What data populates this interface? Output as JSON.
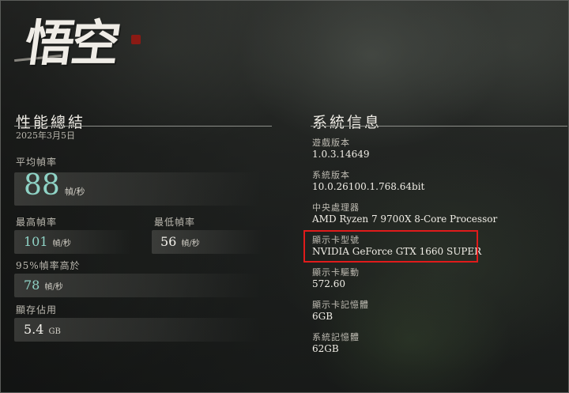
{
  "logo": {
    "text": "悟空"
  },
  "performance": {
    "title": "性能總結",
    "date": "2025年3月5日",
    "avg_fps": {
      "label": "平均幀率",
      "value": "88",
      "unit": "幀/秒"
    },
    "max_fps": {
      "label": "最高幀率",
      "value": "101",
      "unit": "幀/秒"
    },
    "min_fps": {
      "label": "最低幀率",
      "value": "56",
      "unit": "幀/秒"
    },
    "p95_fps": {
      "label": "95%幀率高於",
      "value": "78",
      "unit": "幀/秒"
    },
    "vram": {
      "label": "顯存佔用",
      "value": "5.4",
      "unit": "GB"
    }
  },
  "system": {
    "title": "系統信息",
    "items": [
      {
        "label": "遊戲版本",
        "value": "1.0.3.14649"
      },
      {
        "label": "系統版本",
        "value": "10.0.26100.1.768.64bit"
      },
      {
        "label": "中央處理器",
        "value": "AMD Ryzen 7 9700X 8-Core Processor"
      },
      {
        "label": "顯示卡型號",
        "value": "NVIDIA GeForce GTX 1660 SUPER"
      },
      {
        "label": "顯示卡驅動",
        "value": "572.60"
      },
      {
        "label": "顯示卡記憶體",
        "value": "6GB"
      },
      {
        "label": "系統記憶體",
        "value": "62GB"
      }
    ]
  },
  "colors": {
    "accent": "#8fd3c6",
    "highlight": "#e01b1b"
  }
}
